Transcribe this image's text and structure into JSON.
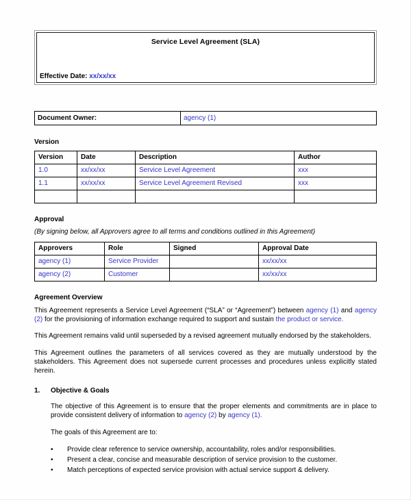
{
  "document": {
    "title": "Service Level Agreement (SLA)",
    "effective_date_label": "Effective Date:",
    "effective_date_value": "xx/xx/xx"
  },
  "owner": {
    "label": "Document Owner:",
    "value": "agency (1)"
  },
  "version_section": {
    "heading": "Version",
    "columns": [
      "Version",
      "Date",
      "Description",
      "Author"
    ],
    "rows": [
      [
        "1.0",
        "xx/xx/xx",
        "Service Level Agreement",
        "xxx"
      ],
      [
        "1.1",
        "xx/xx/xx",
        "Service Level Agreement Revised",
        "xxx"
      ],
      [
        "",
        "",
        "",
        ""
      ]
    ]
  },
  "approval_section": {
    "heading": "Approval",
    "note": "(By signing below, all Approvers agree to all terms and conditions outlined in this Agreement)",
    "columns": [
      "Approvers",
      "Role",
      "Signed",
      "Approval Date"
    ],
    "rows": [
      [
        "agency (1)",
        "Service Provider",
        "",
        "xx/xx/xx"
      ],
      [
        "agency (2)",
        "Customer",
        "",
        "xx/xx/xx"
      ]
    ]
  },
  "overview": {
    "heading": "Agreement Overview",
    "p1_a": "This Agreement represents a Service Level Agreement (“SLA” or “Agreement”) between ",
    "p1_agency1": "agency (1)",
    "p1_b": " and ",
    "p1_agency2": "agency (2)",
    "p1_c": " for the provisioning of information exchange required to support and sustain ",
    "p1_product": "the product or service",
    "p1_d": ".",
    "p2": "This Agreement remains valid until superseded by a revised agreement mutually endorsed by the stakeholders.",
    "p3": "This Agreement outlines the parameters of all services covered as they are mutually understood by the stakeholders. This Agreement does not supersede current processes and procedures unless explicitly stated herein."
  },
  "objectives": {
    "number": "1.",
    "heading": "Objective & Goals",
    "p1_a": "The objective of this Agreement is to ensure that the proper elements and commitments are in place to provide consistent delivery of information to ",
    "p1_agency2": "agency (2)",
    "p1_b": " by ",
    "p1_agency1": "agency (1)",
    "p1_c": ".",
    "goals_lead": "The goals of this Agreement are to:",
    "goals": [
      "Provide clear reference to service ownership, accountability, roles and/or responsibilities.",
      "Present a clear, concise and measurable description of service provision to the customer.",
      "Match perceptions of expected service provision with actual service support & delivery."
    ]
  },
  "colors": {
    "placeholder_blue": "#3535c8",
    "text_black": "#000000",
    "border_black": "#000000",
    "border_gray": "#9a9a9a",
    "page_background": "#fefefe"
  }
}
